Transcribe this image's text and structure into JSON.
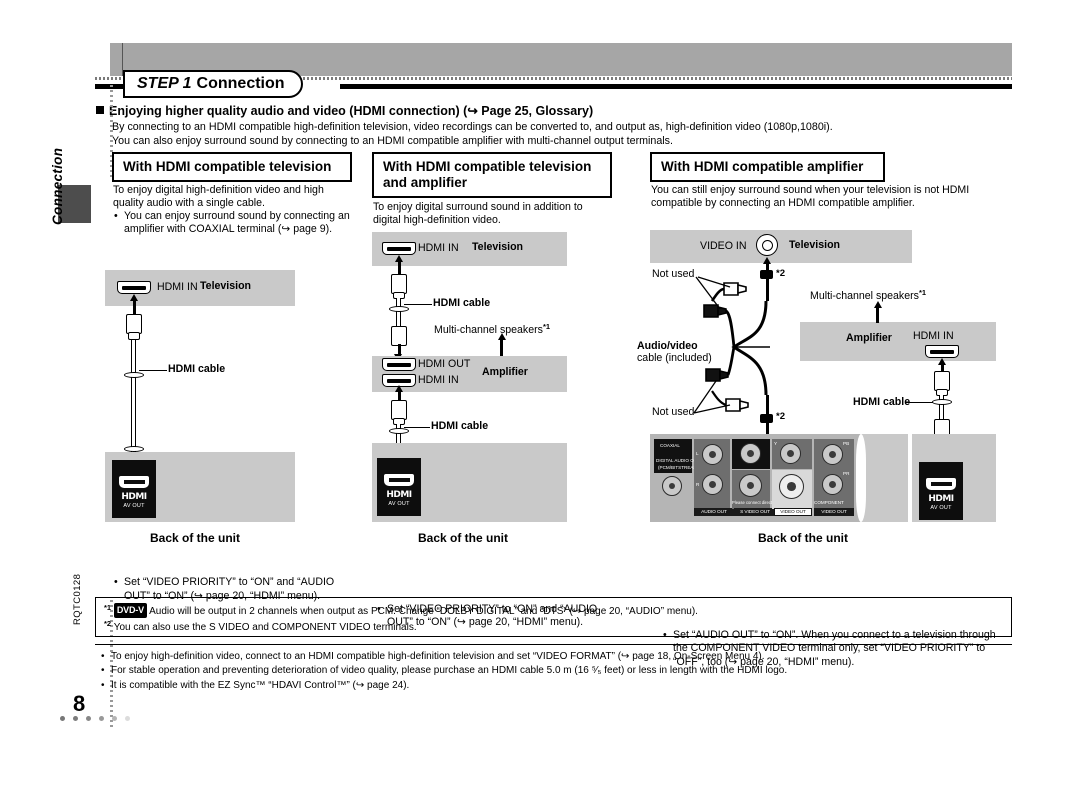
{
  "sidebar": {
    "section_label": "Connection",
    "doc_code": "RQTC0128",
    "page_number": "8"
  },
  "header": {
    "step_italic": "STEP 1",
    "step_title": "Connection",
    "headline": "Enjoying higher quality audio and video (HDMI connection) (↪ Page 25, Glossary)",
    "intro_line1": "By connecting to an HDMI compatible high-definition television, video recordings can be converted to, and output as, high-definition video (1080p,1080i).",
    "intro_line2": "You can also enjoy surround sound by connecting to an HDMI compatible amplifier with multi-channel output terminals."
  },
  "col1": {
    "title": "With HDMI compatible television",
    "desc": "To enjoy digital high-definition video and high quality audio with a single cable.",
    "bullet": "You can enjoy surround sound by connecting an amplifier with COAXIAL terminal (↪ page 9).",
    "tv_port_label": "HDMI IN",
    "tv_label": "Television",
    "cable_label": "HDMI cable",
    "unit_logo": "HDMI",
    "unit_sub": "AV OUT",
    "back_label": "Back of the unit",
    "note": "Set “VIDEO PRIORITY” to “ON” and “AUDIO OUT” to “ON” (↪ page 20, “HDMI” menu)."
  },
  "col2": {
    "title_line1": "With HDMI compatible television",
    "title_line2": "and amplifier",
    "desc": "To enjoy digital surround sound in addition to digital high-definition video.",
    "tv_port_label": "HDMI IN",
    "tv_label": "Television",
    "cable_label_top": "HDMI cable",
    "speakers_label": "Multi-channel speakers",
    "speakers_sup": "*1",
    "amp_out_label": "HDMI OUT",
    "amp_in_label": "HDMI IN",
    "amp_label": "Amplifier",
    "cable_label_bottom": "HDMI cable",
    "unit_logo": "HDMI",
    "unit_sub": "AV OUT",
    "back_label": "Back of the unit",
    "note": "Set “VIDEO PRIORITY” to “ON” and “AUDIO OUT” to “ON” (↪ page 20, “HDMI” menu)."
  },
  "col3": {
    "title": "With HDMI compatible amplifier",
    "desc": "You can still enjoy surround sound when your television is not HDMI compatible by connecting an HDMI compatible amplifier.",
    "tv_port_label": "VIDEO IN",
    "tv_label": "Television",
    "not_used_top": "Not used",
    "not_used_bottom": "Not used",
    "av_cable_bold": "Audio/video",
    "av_cable_rest": "cable (included)",
    "sup2_top": "*2",
    "sup2_bottom": "*2",
    "speakers_label": "Multi-channel speakers",
    "speakers_sup": "*1",
    "amp_label": "Amplifier",
    "amp_port_label": "HDMI IN",
    "cable_label": "HDMI cable",
    "unit_logo": "HDMI",
    "unit_sub": "AV OUT",
    "back_label": "Back of the unit",
    "note": "Set “AUDIO OUT” to “ON”. When you connect to a television through the COMPONENT VIDEO terminal only, set “VIDEO PRIORITY” to “OFF”, too (↪ page 20, “HDMI” menu).",
    "panel": {
      "coaxial": "COAXIAL",
      "digital_out_line1": "DIGITAL AUDIO OUT",
      "digital_out_line2": "(PCM/BITSTREAM)",
      "audio_l": "L",
      "audio_r": "R",
      "audio_out": "AUDIO OUT",
      "s_video_out": "S VIDEO OUT",
      "video_out": "VIDEO OUT",
      "connect_note": "Please connect directly to TV.",
      "comp_y": "Y",
      "comp_pb": "PB",
      "comp_pr": "PR",
      "component_line1": "COMPONENT",
      "component_line2": "VIDEO OUT"
    }
  },
  "footnotes": {
    "fn1_sup": "*1",
    "fn1_badge": "DVD-V",
    "fn1_text": "Audio will be output in 2 channels when output as PCM. Change “DOLBY DIGITAL” and “DTS” (↪ page 20, “AUDIO” menu).",
    "fn2_sup": "*2",
    "fn2_text": "You can also use the S VIDEO and COMPONENT VIDEO terminals."
  },
  "bottom_notes": [
    "To enjoy high-definition video, connect to an HDMI compatible high-definition television and set “VIDEO FORMAT” (↪ page 18, On-Screen Menu 4).",
    "For stable operation and preventing deterioration of video quality, please purchase an HDMI cable 5.0 m (16 ⁵⁄₅ feet) or less in length with the HDMI logo.",
    "It is compatible with the EZ Sync™ “HDAVI Control™” (↪ page 24)."
  ]
}
